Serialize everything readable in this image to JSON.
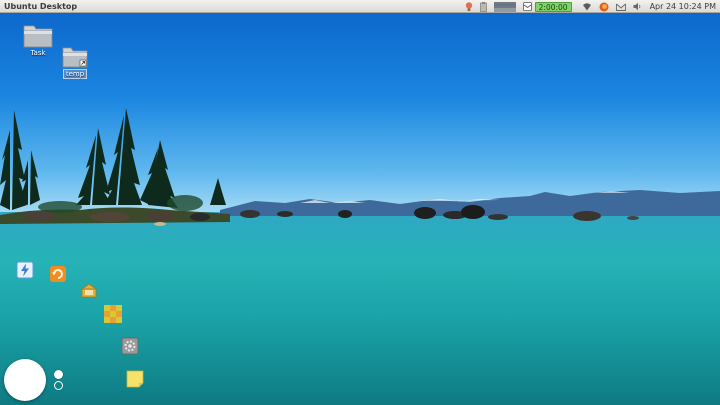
{
  "panel": {
    "title": "Ubuntu Desktop",
    "timer": "2:00:00",
    "clock": "Apr 24 10:24 PM"
  },
  "indicators": [
    {
      "name": "bulb-icon",
      "color": "#e07050"
    },
    {
      "name": "clipboard-icon",
      "color": "#9a9890"
    },
    {
      "name": "cpu-graph-icon",
      "color": "#6f7b86"
    },
    {
      "name": "mail-icon",
      "color": "#555555"
    },
    {
      "name": "wifi-icon",
      "color": "#5d5b55"
    },
    {
      "name": "firefox-icon",
      "color": "#e05a2a"
    },
    {
      "name": "envelope-icon",
      "color": "#6a6862"
    },
    {
      "name": "speaker-icon",
      "color": "#6a6862"
    }
  ],
  "desktop": {
    "icons": [
      {
        "label": "Task",
        "icon": "folder-icon"
      },
      {
        "label": "temp",
        "icon": "folder-link-icon"
      }
    ]
  },
  "dock": {
    "items": [
      {
        "name": "flash-app-icon",
        "color": "#5aa0e0"
      },
      {
        "name": "refresh-app-icon",
        "color": "#f08c20"
      },
      {
        "name": "archive-app-icon",
        "color": "#e0b040"
      },
      {
        "name": "checker-app-icon",
        "color": "#d8c838"
      },
      {
        "name": "settings-app-icon",
        "color": "#888888"
      },
      {
        "name": "sticky-note-icon",
        "color": "#f5e26a"
      }
    ]
  },
  "colors": {
    "panel_bg": "#dcdad5",
    "timer_bg": "#7fd36a",
    "sky_top": "#0b63c9",
    "lake": "#1aa3a8"
  }
}
